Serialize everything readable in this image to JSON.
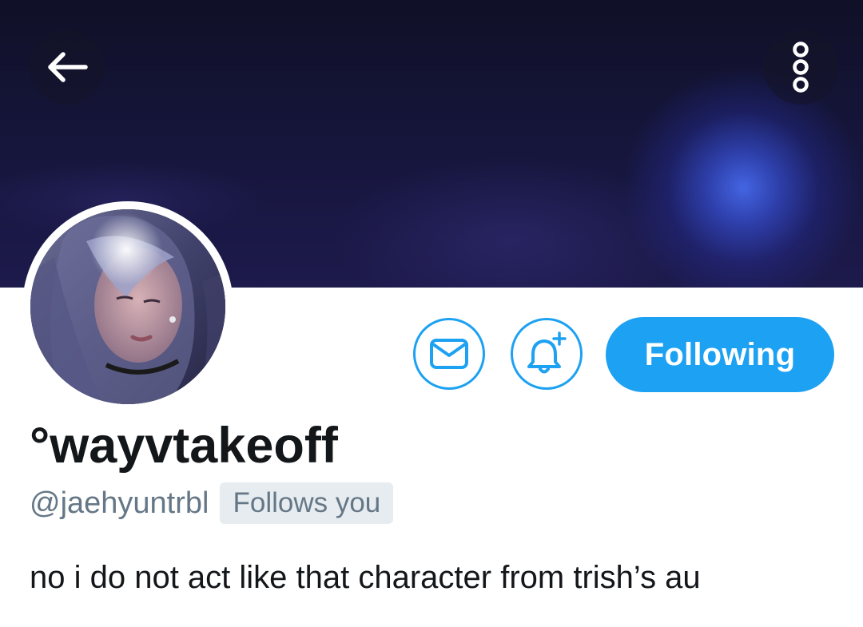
{
  "profile": {
    "display_name": "°wayvtakeoff",
    "handle": "@jaehyuntrbl",
    "follows_you_badge": "Follows you",
    "bio": "no i do not act like that character from trish’s au"
  },
  "actions": {
    "follow_label": "Following"
  },
  "icons": {
    "back": "arrow-left-icon",
    "more": "vertical-ellipsis-icon",
    "message": "envelope-icon",
    "notify": "bell-plus-icon"
  },
  "colors": {
    "accent": "#1da1f2",
    "text_primary": "#14171a",
    "text_secondary": "#657786",
    "badge_bg": "#e6ecf0"
  }
}
